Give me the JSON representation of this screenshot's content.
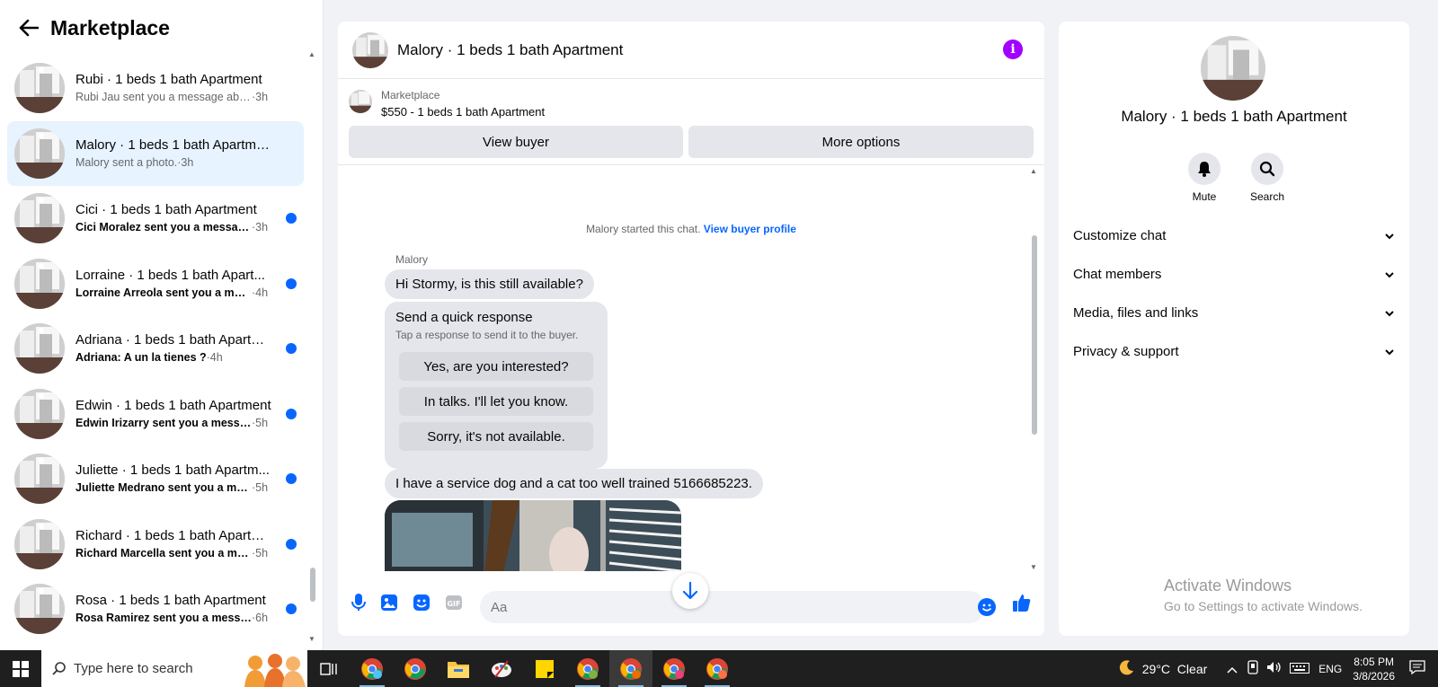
{
  "sidebar": {
    "title": "Marketplace",
    "conversations": [
      {
        "title": "Rubi · 1 beds 1 bath Apartment",
        "snippet": "Rubi Jau sent you a message about...",
        "time": "·3h",
        "unread": false,
        "active": false
      },
      {
        "title": "Malory · 1 beds 1 bath Apartment",
        "snippet": "Malory sent a photo.",
        "time": "·3h",
        "unread": false,
        "active": true
      },
      {
        "title": "Cici · 1 beds 1 bath Apartment",
        "snippet": "Cici Moralez sent you a messag...",
        "time": "·3h",
        "unread": true
      },
      {
        "title": "Lorraine · 1 beds 1 bath Apart...",
        "snippet": "Lorraine Arreola sent you a mes...",
        "time": "·4h",
        "unread": true
      },
      {
        "title": "Adriana · 1 beds 1 bath Apartm...",
        "snippet": "Adriana: A un la tienes ?",
        "time": "·4h",
        "unread": true
      },
      {
        "title": "Edwin · 1 beds 1 bath Apartment",
        "snippet": "Edwin Irizarry sent you a messa...",
        "time": "·5h",
        "unread": true
      },
      {
        "title": "Juliette · 1 beds 1 bath Apartm...",
        "snippet": "Juliette Medrano sent you a me...",
        "time": "·5h",
        "unread": true
      },
      {
        "title": "Richard · 1 beds 1 bath Apartm...",
        "snippet": "Richard Marcella sent you a mes...",
        "time": "·5h",
        "unread": true
      },
      {
        "title": "Rosa · 1 beds 1 bath Apartment",
        "snippet": "Rosa Ramirez sent you a messa...",
        "time": "·6h",
        "unread": true
      }
    ]
  },
  "chat": {
    "title": "Malory · 1 beds 1 bath Apartment",
    "listing_source": "Marketplace",
    "listing_price": "$550 - 1 beds 1 bath Apartment",
    "view_buyer_label": "View buyer",
    "more_options_label": "More options",
    "started_text": "Malory started this chat. ",
    "view_profile_link": "View buyer profile",
    "sender_name": "Malory",
    "message1": "Hi Stormy, is this still available?",
    "quick_title": "Send a quick response",
    "quick_sub": "Tap a response to send it to the buyer.",
    "quick_options": [
      "Yes, are you interested?",
      "In talks. I'll let you know.",
      "Sorry, it's not available."
    ],
    "message2": "I have a service dog and a cat too well trained 5166685223.",
    "composer_placeholder": "Aa"
  },
  "details": {
    "title": "Malory · 1 beds 1 bath Apartment",
    "mute_label": "Mute",
    "search_label": "Search",
    "sections": [
      "Customize chat",
      "Chat members",
      "Media, files and links",
      "Privacy & support"
    ]
  },
  "watermark": {
    "line1": "Activate Windows",
    "line2": "Go to Settings to activate Windows."
  },
  "taskbar": {
    "search_placeholder": "Type here to search",
    "weather": "29°C  Clear",
    "lang": "ENG",
    "time": "8:05 PM",
    "date": "3/8/2026"
  },
  "colors": {
    "accent": "#0866ff",
    "info": "#a200ff",
    "active_row": "#e7f3ff"
  }
}
